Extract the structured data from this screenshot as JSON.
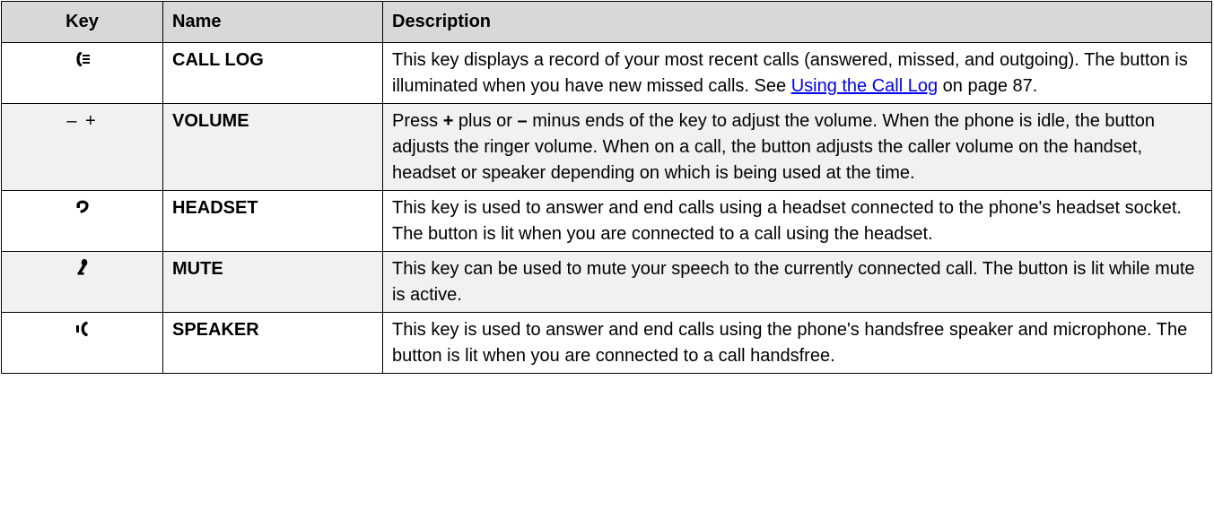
{
  "headers": {
    "key": "Key",
    "name": "Name",
    "description": "Description"
  },
  "rows": [
    {
      "icon": "call-log-icon",
      "name": "CALL LOG",
      "desc_before": "This key displays a record of your most recent calls (answered, missed, and outgoing). The button is illuminated when you have new missed calls. See ",
      "link": "Using the Call Log",
      "desc_after": " on page 87."
    },
    {
      "key_text": "– +",
      "name": "VOLUME",
      "desc_pre": "Press ",
      "plus": "+",
      "desc_mid": " plus or ",
      "minus": "–",
      "desc_post": " minus ends of the key to adjust the volume. When the phone is idle, the button adjusts the ringer volume. When on a call, the button adjusts the caller volume on the handset, headset or speaker depending on which is being used at the time."
    },
    {
      "icon": "headset-icon",
      "name": "HEADSET",
      "desc": "This key is used to answer and end calls using a headset connected to the phone's headset socket. The button is lit when you are connected to a call using the headset."
    },
    {
      "icon": "mute-icon",
      "name": "MUTE",
      "desc": "This key can be used to mute your speech to the currently connected call. The button is lit while mute is active."
    },
    {
      "icon": "speaker-icon",
      "name": "SPEAKER",
      "desc": "This key is used to answer and end calls using the phone's handsfree speaker and microphone. The button is lit when you are connected to a call handsfree."
    }
  ]
}
